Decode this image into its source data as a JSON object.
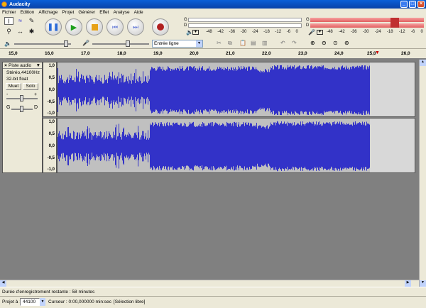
{
  "window": {
    "title": "Audacity"
  },
  "menu": [
    "Fichier",
    "Edition",
    "Affichage",
    "Projet",
    "Générer",
    "Effet",
    "Analyse",
    "Aide"
  ],
  "meters": {
    "left_label": "G",
    "right_label": "D",
    "scale": [
      "-48",
      "-42",
      "-36",
      "-30",
      "-24",
      "-18",
      "-12",
      "-6",
      "0"
    ]
  },
  "mixer": {
    "input_source": "Entrée ligne"
  },
  "ruler": {
    "ticks": [
      "15,0",
      "16,0",
      "17,0",
      "18,0",
      "19,0",
      "20,0",
      "21,0",
      "22,0",
      "23,0",
      "24,0",
      "25,0",
      "26,0"
    ]
  },
  "track": {
    "name": "Piste audio",
    "info1": "Stéréo,44100Hz",
    "info2": "32-bit float",
    "mute_label": "Muet",
    "solo_label": "Solo",
    "gain_minus": "-",
    "gain_plus": "+",
    "pan_left": "G",
    "pan_right": "D",
    "vruler": [
      "1,0",
      "0,5",
      "0,0",
      "-0,5",
      "-1,0"
    ]
  },
  "status": {
    "recording_left": "Durée d'enregistrement restante : 58 minutes",
    "project_rate_label": "Projet à :",
    "project_rate_value": "44100",
    "cursor": "Curseur : 0:00,000000 min:sec",
    "selection": "[Sélection libre]"
  },
  "colors": {
    "wave": "#3232c8",
    "titlebar": "#0a5fd8",
    "meter_red": "#e06060"
  }
}
